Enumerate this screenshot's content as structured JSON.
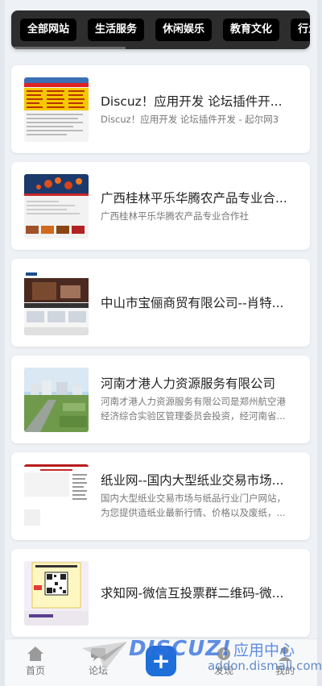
{
  "categories": [
    "全部网站",
    "生活服务",
    "休闲娱乐",
    "教育文化",
    "行业"
  ],
  "items": [
    {
      "title": "Discuz！应用开发 论坛插件开...",
      "desc": "Discuz！应用开发 论坛插件开发 - 起尔网3",
      "thumb": "forum-screenshot-thumbnail"
    },
    {
      "title": "广西桂林平乐华腾农产品专业合...",
      "desc": "广西桂林平乐华腾农产品专业合作社",
      "thumb": "fruit-website-thumbnail"
    },
    {
      "title": "中山市宝俪商贸有限公司--肖特...",
      "desc": "",
      "thumb": "trade-company-thumbnail"
    },
    {
      "title": "河南才港人力资源服务有限公司",
      "desc": "河南才港人力资源服务有限公司是郑州航空港经济综合实验区管理委员会投资，经河南省...",
      "thumb": "city-aerial-thumbnail"
    },
    {
      "title": "纸业网--国内大型纸业交易市场...",
      "desc": "国内大型纸业交易市场与纸品行业门户网站，为您提供造纸业最新行情、价格以及废纸，...",
      "thumb": "paper-site-thumbnail"
    },
    {
      "title": "求知网-微信互投票群二维码-微...",
      "desc": "",
      "thumb": "qr-code-thumbnail"
    }
  ],
  "tabbar": {
    "home": "首页",
    "forum": "论坛",
    "add": "+",
    "discover": "发现",
    "mine": "我的"
  },
  "watermark": {
    "logo": "DISCUZ!",
    "sub": "应用中心",
    "url": "addon.dismall.com"
  }
}
